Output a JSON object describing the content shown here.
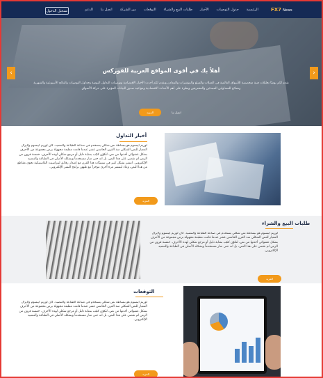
{
  "nav": {
    "logo_main": "FX7",
    "logo_sub": "News",
    "login_label": "تسجيل الدخول",
    "menu": [
      "الرئيسية",
      "جدول التوصيات",
      "الأخبار",
      "طلبات البيع والشراء",
      "التوقعات",
      "من الشركة",
      "اتصل بنا",
      "الدعم"
    ]
  },
  "hero": {
    "title": "أهلاً بك في أقوى المواقع العربية للفوركس",
    "text": "نقدم لكم يوميًا تحليلات فنية متخصصة للأسواق العالمية في العملات والسلع والمؤشرات والمعادن ونقدم لكم أحدث الأخبار الاقتصادية وتوصيات التداول اليومية وجداول التوصيات والنتائج الأسبوعية والشهرية ونصائح للمتداولين المبتدئين والمحترفين ونظرة على أهم الأحداث الاقتصادية ومواعيد صدور البيانات المؤثرة على حركة الأسواق",
    "more_label": "المزيد",
    "contact_label": "اتصل بنا",
    "prev_icon": "‹",
    "next_icon": "›"
  },
  "sections": [
    {
      "title": "أخبار التداول",
      "body": "لوريم ايبسوم هو ببساطة نص شكلي يستخدم في صناعة الطباعة والتنضيد. كان لوريم ايبسوم ولايزال المعيار للنص الشكلي منذ القرن الخامس عشر عندما قامت مطبعة مجهولة برص مجموعة من الأحرف بشكل عشوائي أخذتها من نص، لتكوّن كتيّب بمثابة دليل أو مرجع شكلي لهذه الأحرف. خمسة قرون من الزمن لم تقضي على هذا النص، بل انه حتى صار مستخدماً وبشكله الأصلي في الطباعة والتنضيد الإلكتروني. انتشر بشكل كبير في ستينيّات هذا القرن مع إصدار رقائق ليتراسيت البلاستيكية تحوي مقاطع من هذا النص، وعاد لينتشر مرة أخرى مؤخراَ مع ظهور برامج النشر الإلكتروني.",
      "more_label": "المزيد"
    },
    {
      "title": "طلبات البيع والشراء",
      "body": "لوريم ايبسوم هو ببساطة نص شكلي يستخدم في صناعة الطباعة والتنضيد. كان لوريم ايبسوم ولايزال المعيار للنص الشكلي منذ القرن الخامس عشر عندما قامت مطبعة مجهولة برص مجموعة من الأحرف بشكل عشوائي أخذتها من نص، لتكوّن كتيّب بمثابة دليل أو مرجع شكلي لهذه الأحرف. خمسة قرون من الزمن لم تقضي على هذا النص، بل انه حتى صار مستخدماً وبشكله الأصلي في الطباعة والتنضيد الإلكتروني.",
      "more_label": "المزيد"
    },
    {
      "title": "التوقعات",
      "body": "لوريم ايبسوم هو ببساطة نص شكلي يستخدم في صناعة الطباعة والتنضيد. كان لوريم ايبسوم ولايزال المعيار للنص الشكلي منذ القرن الخامس عشر عندما قامت مطبعة مجهولة برص مجموعة من الأحرف بشكل عشوائي أخذتها من نص، لتكوّن كتيّب بمثابة دليل أو مرجع شكلي لهذه الأحرف. خمسة قرون من الزمن لم تقضي على هذا النص، بل انه حتى صار مستخدماً وبشكله الأصلي في الطباعة والتنضيد الإلكتروني.",
      "more_label": "المزيد"
    }
  ],
  "colors": {
    "nav_bg": "#152a55",
    "accent": "#f29a1b",
    "frame_border": "#e53935"
  }
}
